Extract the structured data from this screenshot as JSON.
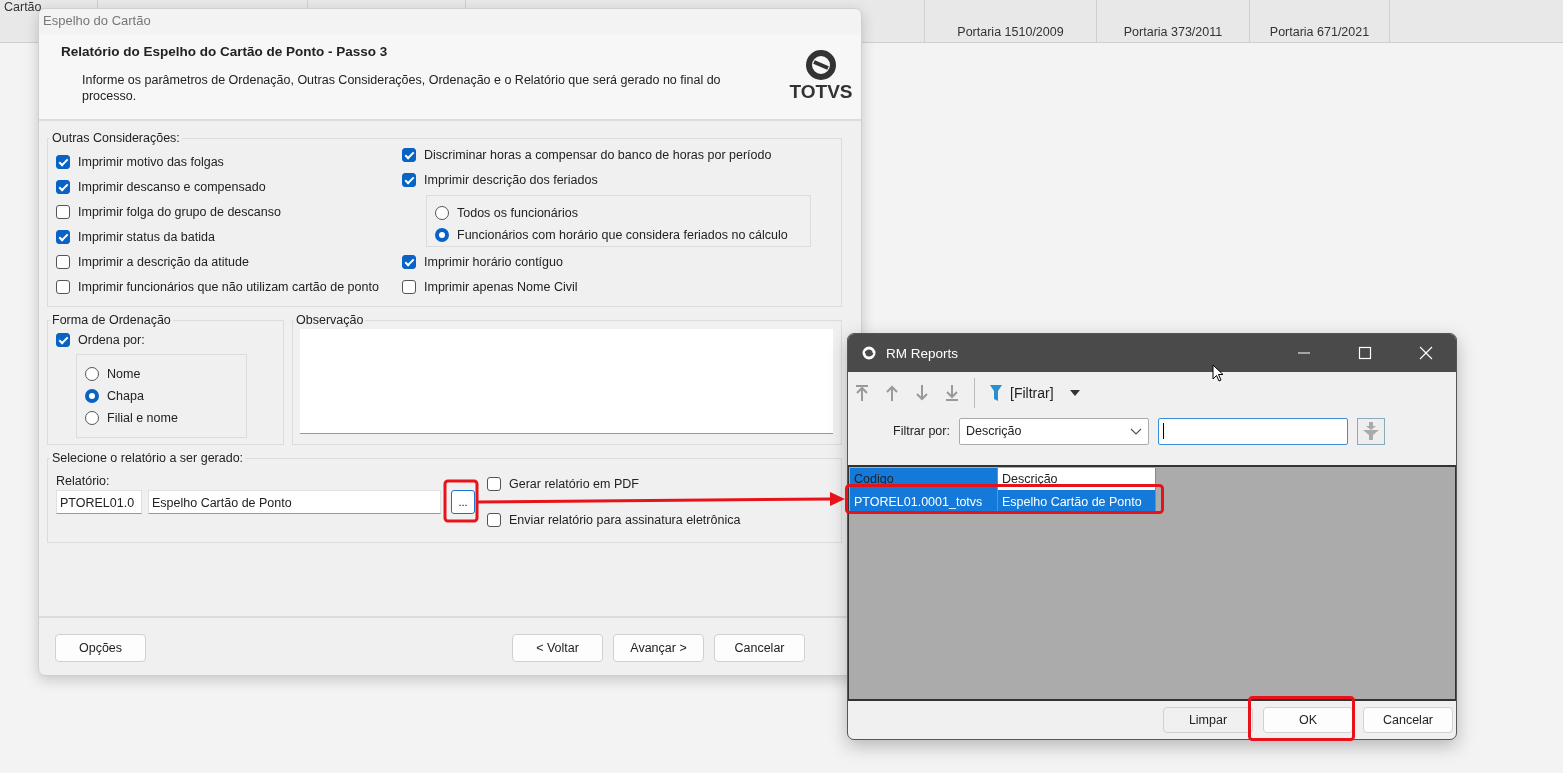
{
  "background": {
    "columns": [
      {
        "label": "Cartão"
      },
      {
        "label": "Portaria 1510/2009"
      },
      {
        "label": "Portaria 373/2011"
      },
      {
        "label": "Portaria 671/2021"
      }
    ]
  },
  "dialog": {
    "title": "Espelho do Cartão",
    "heading": "Relatório do Espelho do Cartão de Ponto - Passo 3",
    "description": "Informe os parâmetros de Ordenação, Outras Considerações, Ordenação e o Relatório que será gerado no final do processo.",
    "logo_text": "TOTVS",
    "consideracoes": {
      "legend": "Outras Considerações:",
      "left": [
        {
          "label": "Imprimir motivo das folgas",
          "checked": true
        },
        {
          "label": "Imprimir descanso e compensado",
          "checked": true
        },
        {
          "label": "Imprimir folga do grupo de descanso",
          "checked": false
        },
        {
          "label": "Imprimir status da batida",
          "checked": true
        },
        {
          "label": "Imprimir a descrição da atitude",
          "checked": false
        },
        {
          "label": "Imprimir funcionários que não utilizam cartão de ponto",
          "checked": false
        }
      ],
      "right": [
        {
          "kind": "checkbox",
          "label": "Discriminar horas a compensar do banco de horas por período",
          "checked": true
        },
        {
          "kind": "checkbox",
          "label": "Imprimir descrição dos feriados",
          "checked": true
        },
        {
          "kind": "radio_group",
          "options": [
            {
              "label": "Todos os funcionários",
              "selected": false
            },
            {
              "label": "Funcionários com horário que considera feriados no cálculo",
              "selected": true
            }
          ]
        },
        {
          "kind": "checkbox",
          "label": "Imprimir horário contíguo",
          "checked": true
        },
        {
          "kind": "checkbox",
          "label": "Imprimir apenas Nome Civil",
          "checked": false
        }
      ]
    },
    "ordenacao": {
      "legend": "Forma de Ordenação",
      "checkbox": {
        "label": "Ordena por:",
        "checked": true
      },
      "options": [
        {
          "label": "Nome",
          "selected": false
        },
        {
          "label": "Chapa",
          "selected": true
        },
        {
          "label": "Filial e nome",
          "selected": false
        }
      ]
    },
    "observacao": {
      "legend": "Observação"
    },
    "relatorio": {
      "legend": "Selecione o relatório a ser gerado:",
      "label": "Relatório:",
      "code": "PTOREL01.0",
      "name": "Espelho Cartão de Ponto",
      "browse": "...",
      "options": [
        {
          "label": "Gerar relatório em PDF",
          "checked": false
        },
        {
          "label": "Enviar relatório para assinatura eletrônica",
          "checked": false
        }
      ]
    },
    "buttons_left": [
      "Opções"
    ],
    "buttons_right": [
      "< Voltar",
      "Avançar >",
      "Cancelar"
    ]
  },
  "reports": {
    "title": "RM Reports",
    "toolbar": {
      "nav_disabled": true,
      "filter": "[Filtrar]"
    },
    "filter_row": {
      "label": "Filtrar por:",
      "field": "Descrição"
    },
    "grid": {
      "columns": [
        {
          "label": "Codigo",
          "selected": true
        },
        {
          "label": "Descrição",
          "selected": false
        }
      ],
      "rows": [
        {
          "cells": [
            "PTOREL01.0001_totvs",
            "Espelho Cartão de Ponto"
          ],
          "selected": true
        }
      ]
    },
    "buttons": [
      "Limpar",
      "OK",
      "Cancelar"
    ]
  }
}
